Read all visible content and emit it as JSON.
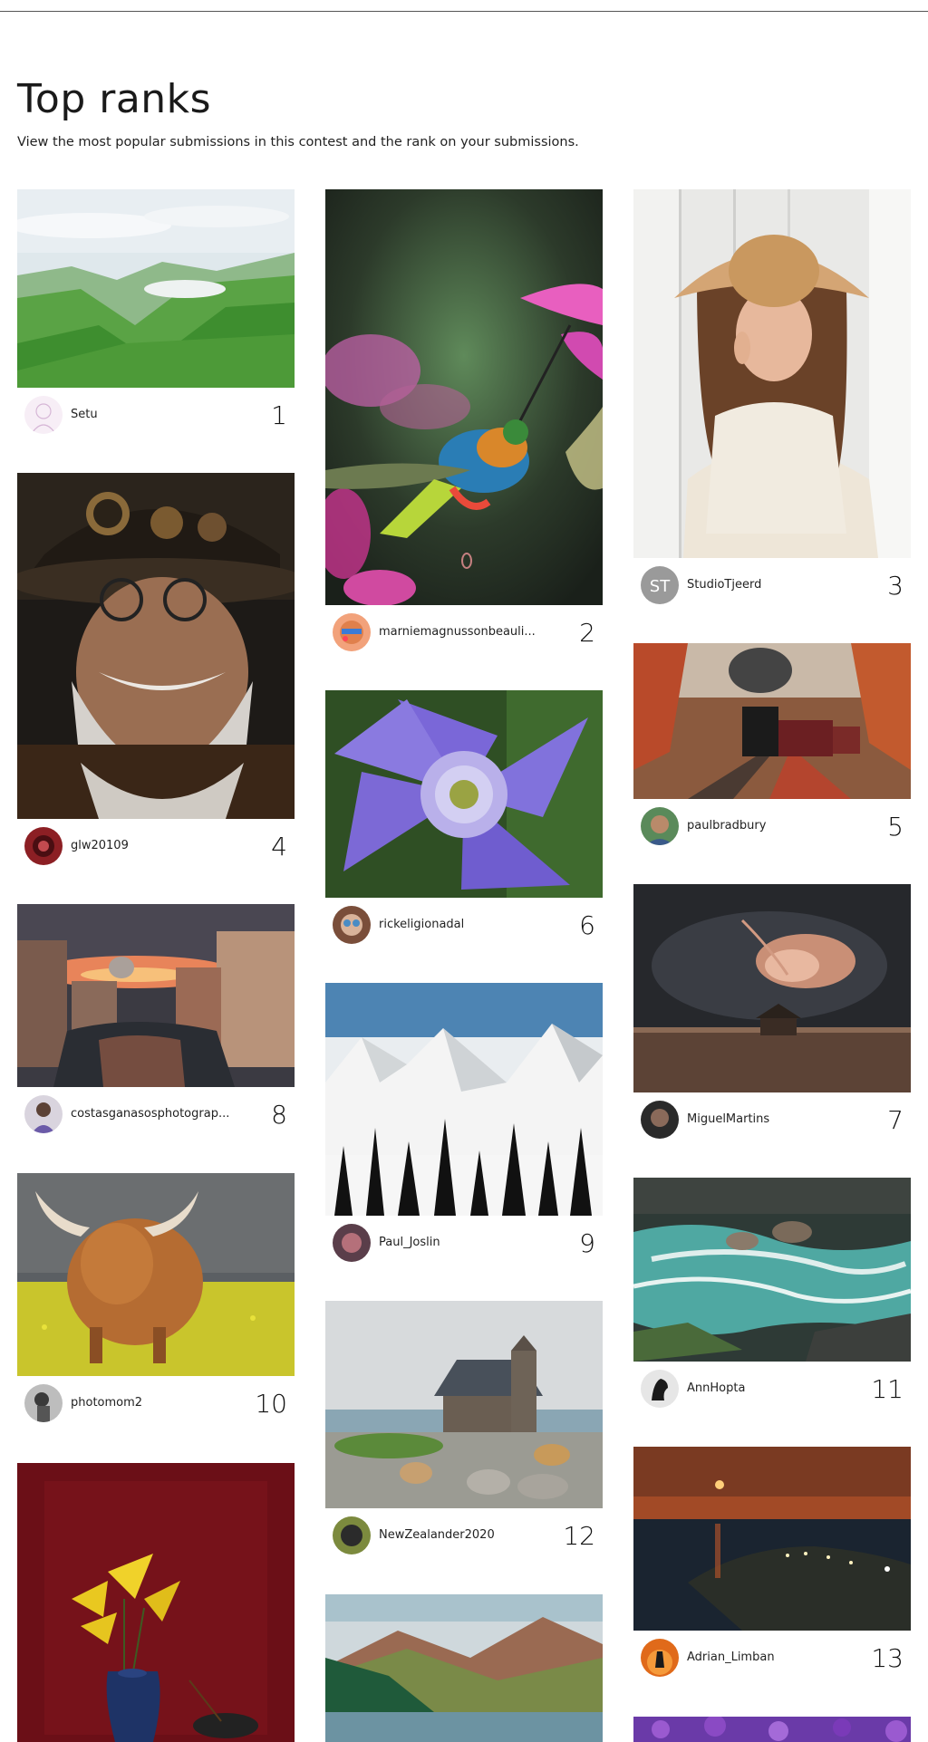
{
  "page": {
    "title": "Top ranks",
    "subtitle": "View the most popular submissions in this contest and the rank on your submissions."
  },
  "entries": [
    {
      "rank": "1",
      "user": "Setu",
      "image": "green-mountain-valley"
    },
    {
      "rank": "2",
      "user": "marniemagnussonbeauli...",
      "image": "hummingbird-pink-flower"
    },
    {
      "rank": "3",
      "user": "StudioTjeerd",
      "image": "girl-straw-hat"
    },
    {
      "rank": "4",
      "user": "glw20109",
      "image": "steampunk-old-man"
    },
    {
      "rank": "5",
      "user": "paulbradbury",
      "image": "steam-train-autumn-forest"
    },
    {
      "rank": "6",
      "user": "rickeligionadal",
      "image": "purple-clematis-flower"
    },
    {
      "rank": "7",
      "user": "MiguelMartins",
      "image": "storm-over-barn"
    },
    {
      "rank": "8",
      "user": "costasganasosphotograp...",
      "image": "venice-canal-sunset"
    },
    {
      "rank": "9",
      "user": "Paul_Joslin",
      "image": "snowy-mountains-pines"
    },
    {
      "rank": "10",
      "user": "photomom2",
      "image": "highland-cow-rapeseed"
    },
    {
      "rank": "11",
      "user": "AnnHopta",
      "image": "turquoise-river-rocks"
    },
    {
      "rank": "12",
      "user": "NewZealander2020",
      "image": "stone-church-lake"
    },
    {
      "rank": "13",
      "user": "Adrian_Limban",
      "image": "night-bay-moon"
    },
    {
      "rank": "",
      "user": "",
      "image": "yellow-lilies-blue-vase"
    },
    {
      "rank": "",
      "user": "",
      "image": "mountain-lake-forest"
    },
    {
      "rank": "",
      "user": "",
      "image": "purple-flowers"
    }
  ],
  "avatar_labels": {
    "studiotjeerd": "ST"
  }
}
